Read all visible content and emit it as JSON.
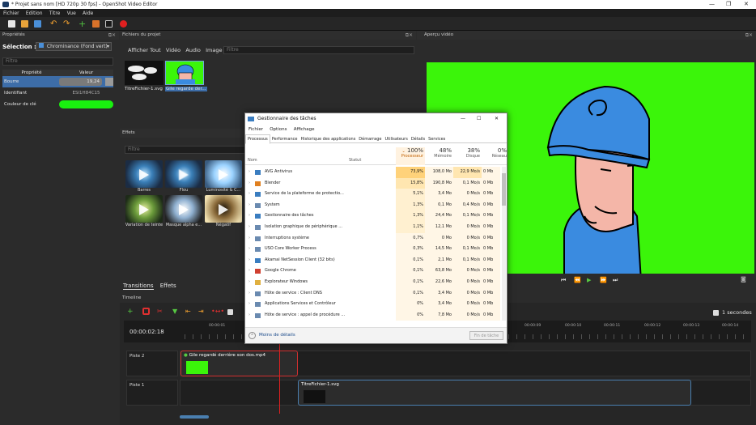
{
  "window": {
    "title": "* Projet sans nom [HD 720p 30 fps] - OpenShot Video Editor"
  },
  "menu": [
    "Fichier",
    "Edition",
    "Titre",
    "Vue",
    "Aide"
  ],
  "properties": {
    "header": "Propriétés",
    "selection_label": "Sélection :",
    "selection_value": "Chrominance (Fond vert)",
    "filter_placeholder": "Filtre",
    "col_property": "Propriété",
    "col_value": "Valeur",
    "rows": [
      {
        "name": "Bourre",
        "value": "19,24"
      },
      {
        "name": "Identifiant",
        "value": "ESI1H84C15"
      },
      {
        "name": "Couleur de clé",
        "value": ""
      }
    ],
    "key_color": "#19f00f"
  },
  "files": {
    "header": "Fichiers du projet",
    "tabs": [
      "Afficher Tout",
      "Vidéo",
      "Audio",
      "Image"
    ],
    "filter_placeholder": "Filtre",
    "items": [
      {
        "label": "TitreFichier-1.svg"
      },
      {
        "label": "Gile regarde der..."
      }
    ]
  },
  "effects": {
    "header": "Effets",
    "filter_placeholder": "Filtre",
    "items": [
      "Barres",
      "Flou",
      "Luminosité & C...",
      "Variation de teinte",
      "Masque alpha e...",
      "Négatif"
    ]
  },
  "bottom_tabs": [
    "Transitions",
    "Effets"
  ],
  "preview": {
    "header": "Aperçu vidéo",
    "controls": [
      "⏮",
      "⏪",
      "▶",
      "⏩",
      "⏭"
    ]
  },
  "timeline": {
    "header": "Timeline",
    "time": "00:00:02:18",
    "zoom_label": "1 secondes",
    "ticks": [
      "00:00:01",
      "00:00:09",
      "00:00:10",
      "00:00:11",
      "00:00:12",
      "00:00:13",
      "00:00:14"
    ],
    "tracks": [
      {
        "name": "Piste 2",
        "clip": "Gile regardé derrière son dos.mp4"
      },
      {
        "name": "Piste 1",
        "clip": "TitreFichier-1.svg"
      }
    ]
  },
  "taskmanager": {
    "title": "Gestionnaire des tâches",
    "menu": [
      "Fichier",
      "Options",
      "Affichage"
    ],
    "tabs": [
      "Processus",
      "Performance",
      "Historique des applications",
      "Démarrage",
      "Utilisateurs",
      "Détails",
      "Services"
    ],
    "col_name": "Nom",
    "col_status": "Statut",
    "cpu_total": "100%",
    "cpu_label": "Processeur",
    "mem_total": "48%",
    "mem_label": "Mémoire",
    "disk_total": "38%",
    "disk_label": "Disque",
    "net_total": "0%",
    "net_label": "Réseau",
    "rows": [
      {
        "name": "AVG Antivirus",
        "cpu": "73,9%",
        "mem": "108,0 Mo",
        "disk": "22,9 Mo/s",
        "net": "0 Mb"
      },
      {
        "name": "Blender",
        "cpu": "15,8%",
        "mem": "190,8 Mo",
        "disk": "0,1 Mo/s",
        "net": "0 Mb"
      },
      {
        "name": "Service de la plateforme de protectio...",
        "cpu": "5,1%",
        "mem": "3,4 Mo",
        "disk": "0 Mo/s",
        "net": "0 Mb"
      },
      {
        "name": "System",
        "cpu": "1,3%",
        "mem": "0,1 Mo",
        "disk": "0,4 Mo/s",
        "net": "0 Mb"
      },
      {
        "name": "Gestionnaire des tâches",
        "cpu": "1,3%",
        "mem": "24,4 Mo",
        "disk": "0,1 Mo/s",
        "net": "0 Mb"
      },
      {
        "name": "Isolation graphique de périphérique ...",
        "cpu": "1,1%",
        "mem": "12,1 Mo",
        "disk": "0 Mo/s",
        "net": "0 Mb"
      },
      {
        "name": "Interruptions système",
        "cpu": "0,7%",
        "mem": "0 Mo",
        "disk": "0 Mo/s",
        "net": "0 Mb"
      },
      {
        "name": "USO Core Worker Process",
        "cpu": "0,3%",
        "mem": "14,5 Mo",
        "disk": "0,1 Mo/s",
        "net": "0 Mb"
      },
      {
        "name": "Akamai NetSession Client (32 bits)",
        "cpu": "0,1%",
        "mem": "2,1 Mo",
        "disk": "0,1 Mo/s",
        "net": "0 Mb"
      },
      {
        "name": "Google Chrome",
        "cpu": "0,1%",
        "mem": "63,8 Mo",
        "disk": "0 Mo/s",
        "net": "0 Mb"
      },
      {
        "name": "Explorateur Windows",
        "cpu": "0,1%",
        "mem": "22,6 Mo",
        "disk": "0 Mo/s",
        "net": "0 Mb"
      },
      {
        "name": "Hôte de service : Client DNS",
        "cpu": "0,1%",
        "mem": "3,4 Mo",
        "disk": "0 Mo/s",
        "net": "0 Mb"
      },
      {
        "name": "Applications Services et Contrôleur",
        "cpu": "0%",
        "mem": "3,4 Mo",
        "disk": "0 Mo/s",
        "net": "0 Mb"
      },
      {
        "name": "Hôte de service : appel de procédure ...",
        "cpu": "0%",
        "mem": "7,8 Mo",
        "disk": "0 Mo/s",
        "net": "0 Mb"
      }
    ],
    "less_details": "Moins de détails",
    "end_task": "Fin de tâche"
  }
}
